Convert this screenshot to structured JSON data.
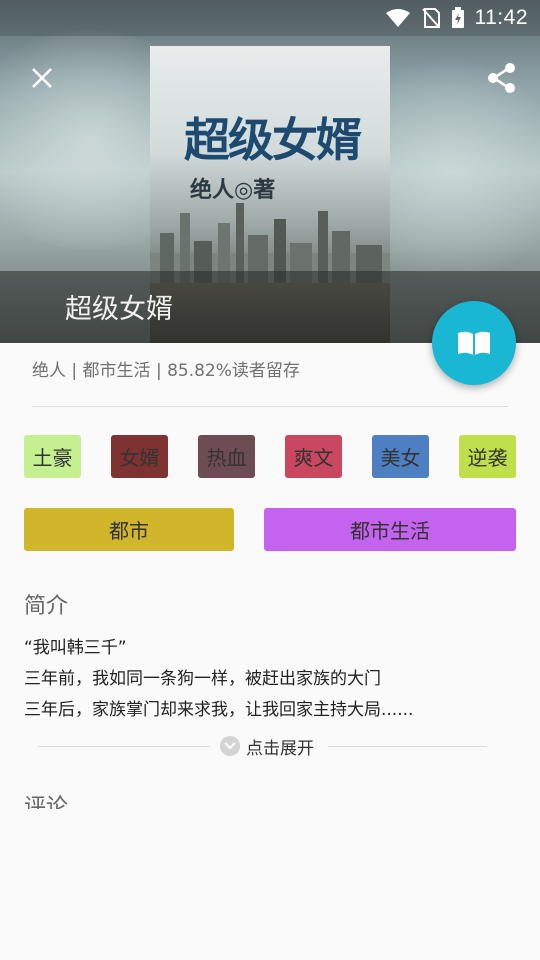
{
  "status_bar": {
    "time": "11:42"
  },
  "book": {
    "title": "超级女婿",
    "cover_title": "超级女婿",
    "cover_author": "绝人◎著",
    "meta": "绝人 | 都市生活 | 85.82%读者留存"
  },
  "tags": [
    {
      "label": "土豪",
      "color": "#c4f08f"
    },
    {
      "label": "女婿",
      "color": "#7f3232"
    },
    {
      "label": "热血",
      "color": "#6e4c53"
    },
    {
      "label": "爽文",
      "color": "#c9475f"
    },
    {
      "label": "美女",
      "color": "#4f7fc3"
    },
    {
      "label": "逆袭",
      "color": "#bfe04a"
    }
  ],
  "categories": [
    {
      "label": "都市",
      "color": "#d1b52b"
    },
    {
      "label": "都市生活",
      "color": "#c463ef"
    }
  ],
  "intro": {
    "heading": "简介",
    "lines": [
      "“我叫韩三千”",
      "三年前，我如同一条狗一样，被赶出家族的大门",
      "三年后，家族掌门却来求我，让我回家主持大局......"
    ],
    "expand_label": "点击展开"
  },
  "comments": {
    "heading": "评论"
  },
  "icons": {
    "close": "close-icon",
    "share": "share-icon",
    "read": "book-open-icon",
    "wifi": "wifi-icon",
    "signal": "signal-off-icon",
    "battery": "battery-charging-icon",
    "chevron": "chevron-down-icon"
  }
}
